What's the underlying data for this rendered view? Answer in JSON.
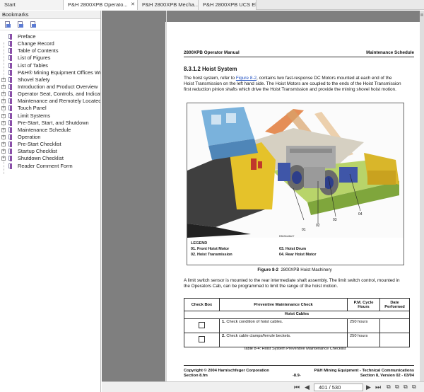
{
  "tabs": [
    {
      "label": "Start",
      "closable": false
    },
    {
      "label": "P&H 2800XPB Operato...",
      "closable": true
    },
    {
      "label": "P&H 2800XPB Mecha...",
      "closable": false
    },
    {
      "label": "P&H 2800XPB UCS El...",
      "closable": false
    }
  ],
  "bookmarks": {
    "title": "Bookmarks",
    "items": [
      {
        "label": "Preface",
        "expandable": false
      },
      {
        "label": "Change Record",
        "expandable": false
      },
      {
        "label": "Table of Contents",
        "expandable": false
      },
      {
        "label": "List of Figures",
        "expandable": false
      },
      {
        "label": "List of Tables",
        "expandable": false
      },
      {
        "label": "P&H® Mining Equipment Offices Worl",
        "expandable": false
      },
      {
        "label": "Shovel Safety",
        "expandable": true
      },
      {
        "label": "Introduction and Product Overview",
        "expandable": true
      },
      {
        "label": "Operator Seat, Controls, and Indicato",
        "expandable": true
      },
      {
        "label": "Maintenance and Remotely Located C",
        "expandable": true
      },
      {
        "label": "Touch Panel",
        "expandable": true
      },
      {
        "label": "Limit Systems",
        "expandable": true
      },
      {
        "label": "Pre-Start, Start, and Shutdown",
        "expandable": true
      },
      {
        "label": "Maintenance Schedule",
        "expandable": true
      },
      {
        "label": "Operation",
        "expandable": true
      },
      {
        "label": "Pre-Start Checklist",
        "expandable": true
      },
      {
        "label": "Startup Checklist",
        "expandable": true
      },
      {
        "label": "Shutdown Checklist",
        "expandable": true
      },
      {
        "label": "Reader Comment Form",
        "expandable": false
      }
    ]
  },
  "doc": {
    "header_left": "2800XPB Operator Manual",
    "header_right": "Maintenance Schedule",
    "section_title": "8.3.1.2 Hoist System",
    "para1_pre": "The hoist system, refer to ",
    "para1_link": "Figure 8-2",
    "para1_post": ", contains two fast-response DC Motors mounted at each end of the Hoist Transmission on the left hand side. The Hoist Motors are coupled to the ends of the Hoist Transmission first reduction pinion shafts which drive the Hoist Transmission and provide the mining shovel hoist motion.",
    "figure": {
      "code": "E8626s68s07",
      "legend_title": "LEGEND",
      "legend": [
        "01.  Front Hoist Motor",
        "02.  Hoist Transmission",
        "03.  Hoist Drum",
        "04.  Rear Hoist Motor"
      ],
      "callouts": [
        "04",
        "03",
        "02",
        "01"
      ],
      "caption_label": "Figure 8-2",
      "caption_text": "2800XPB Hoist Machinery"
    },
    "para2": "A limit switch sensor is mounted to the rear intermediate shaft assembly. The limit switch control, mounted in the Operators Cab, can be programmed to limit the range of the hoist motion.",
    "table": {
      "headers": [
        "Check Box",
        "Preventive Maintenance Check",
        "P.M. Cycle Hours",
        "Date Performed"
      ],
      "group": "Hoist Cables",
      "rows": [
        {
          "num": "1.",
          "text": "Check condition of hoist cables.",
          "hours": "250 hours",
          "date": ""
        },
        {
          "num": "2.",
          "text": "Check cable clamps/ferrule beckets.",
          "hours": "250 hours",
          "date": ""
        }
      ],
      "caption": "Table 8-4: Hoist System Preventive Maintenance Checklist"
    },
    "footer_left_1": "Copyright © 2004 Harnischfeger Corporation",
    "footer_left_2": "Section 8.fm",
    "footer_center": "-8.9-",
    "footer_right_1": "P&H Mining Equipment - Technical Communications",
    "footer_right_2": "Section 8, Version 02 - 03/04"
  },
  "nav": {
    "first": "⏮",
    "prev": "◀",
    "page_display": "401 / 530",
    "next": "▶",
    "last": "⏭",
    "view_icons": [
      "two-page-icon",
      "continuous-icon",
      "facing-icon",
      "single-page-icon"
    ]
  }
}
